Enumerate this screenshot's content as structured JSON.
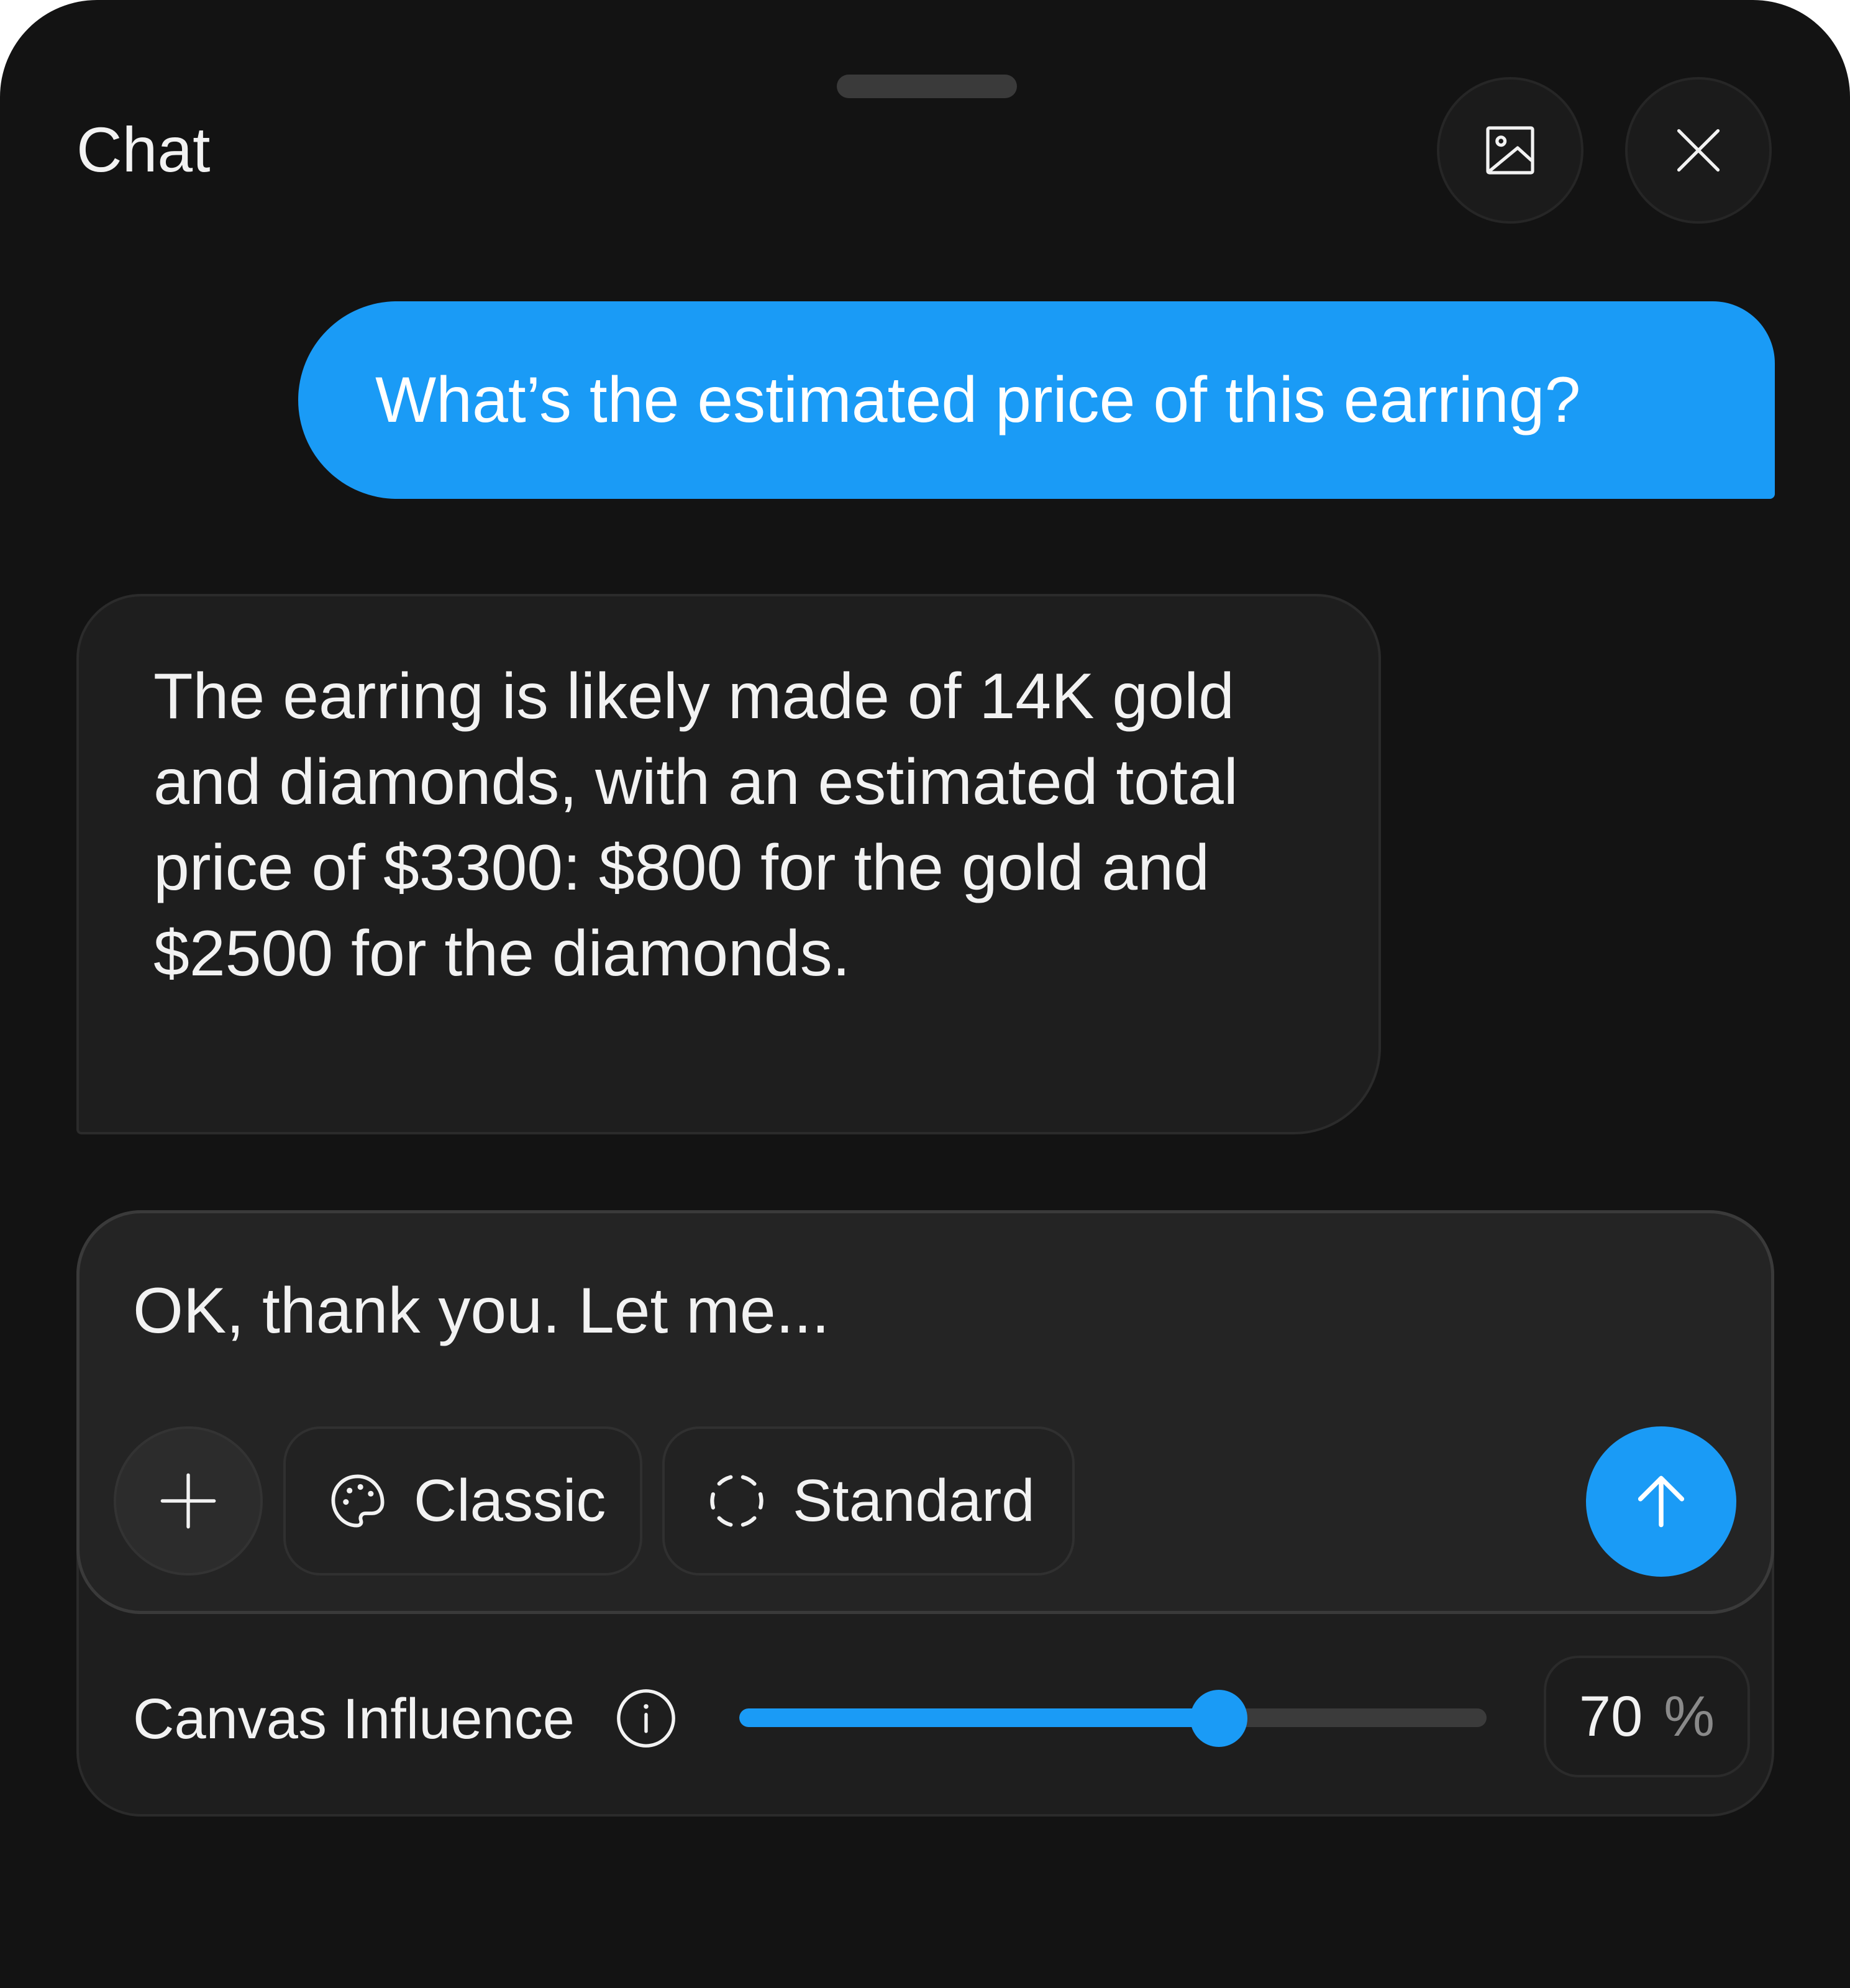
{
  "header": {
    "title": "Chat",
    "image_button_icon": "image-icon",
    "close_button_icon": "close-icon"
  },
  "messages": [
    {
      "role": "user",
      "text": "What’s the estimated price of this earring?"
    },
    {
      "role": "assistant",
      "text": "The earring is likely made of 14K gold and diamonds, with an estimated total price of $3300: $800 for the gold and $2500 for the diamonds."
    }
  ],
  "composer": {
    "input_value": "OK, thank you. Let me...",
    "add_icon": "plus-icon",
    "style_chip": {
      "icon": "palette-icon",
      "label": "Classic"
    },
    "mode_chip": {
      "icon": "dashed-circle-icon",
      "label": "Standard"
    },
    "send_icon": "arrow-up-icon"
  },
  "canvas_influence": {
    "label": "Canvas Influence",
    "info_icon": "info-icon",
    "value": 70,
    "value_text": "70",
    "unit": "%"
  },
  "colors": {
    "background": "#131313",
    "accent": "#1a9bf6",
    "bubble_dark": "#1e1e1e",
    "text": "#f2f2f2"
  }
}
